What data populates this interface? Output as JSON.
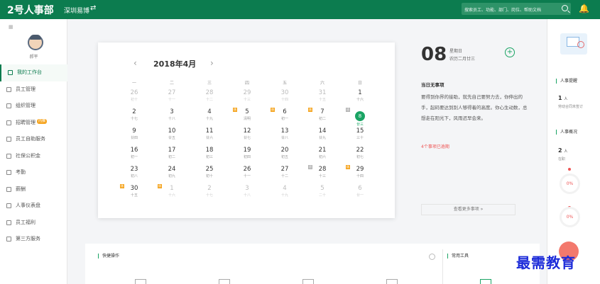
{
  "topbar": {
    "logo": "2号人事部",
    "company": "深圳易博",
    "search_placeholder": "搜索员工、功能、部门、岗位、帮助文档"
  },
  "user": {
    "name": "郝平"
  },
  "sidebar": {
    "items": [
      {
        "label": "我的工作台",
        "active": true
      },
      {
        "label": "员工管理"
      },
      {
        "label": "组织管理"
      },
      {
        "label": "招聘管理",
        "badge": "内推"
      },
      {
        "label": "员工自助服务"
      },
      {
        "label": "社保公积金"
      },
      {
        "label": "考勤"
      },
      {
        "label": "薪酬"
      },
      {
        "label": "人事仪表盘"
      },
      {
        "label": "员工福利"
      },
      {
        "label": "第三方服务"
      }
    ]
  },
  "calendar": {
    "title": "2018年4月",
    "weekdays": [
      "一",
      "二",
      "三",
      "四",
      "五",
      "六",
      "日"
    ],
    "weeks": [
      [
        {
          "n": "26",
          "l": "初十",
          "other": true
        },
        {
          "n": "27",
          "l": "十一",
          "other": true
        },
        {
          "n": "28",
          "l": "十二",
          "other": true
        },
        {
          "n": "29",
          "l": "十三",
          "other": true
        },
        {
          "n": "30",
          "l": "十四",
          "other": true
        },
        {
          "n": "31",
          "l": "十五",
          "other": true
        },
        {
          "n": "1",
          "l": "十六"
        }
      ],
      [
        {
          "n": "2",
          "l": "十七"
        },
        {
          "n": "3",
          "l": "十八"
        },
        {
          "n": "4",
          "l": "十九"
        },
        {
          "n": "5",
          "l": "清明",
          "tag": "休"
        },
        {
          "n": "6",
          "l": "初一",
          "tag": "休"
        },
        {
          "n": "7",
          "l": "初二",
          "tag": "休"
        },
        {
          "n": "8",
          "l": "廿三",
          "today": true,
          "tag": "班",
          "rest": true
        }
      ],
      [
        {
          "n": "9",
          "l": "廿四"
        },
        {
          "n": "10",
          "l": "廿五"
        },
        {
          "n": "11",
          "l": "廿六"
        },
        {
          "n": "12",
          "l": "廿七"
        },
        {
          "n": "13",
          "l": "廿八"
        },
        {
          "n": "14",
          "l": "廿九"
        },
        {
          "n": "15",
          "l": "三十"
        }
      ],
      [
        {
          "n": "16",
          "l": "初一"
        },
        {
          "n": "17",
          "l": "初二"
        },
        {
          "n": "18",
          "l": "初三"
        },
        {
          "n": "19",
          "l": "初四"
        },
        {
          "n": "20",
          "l": "初五"
        },
        {
          "n": "21",
          "l": "初六"
        },
        {
          "n": "22",
          "l": "初七"
        }
      ],
      [
        {
          "n": "23",
          "l": "初八"
        },
        {
          "n": "24",
          "l": "初九"
        },
        {
          "n": "25",
          "l": "初十"
        },
        {
          "n": "26",
          "l": "十一"
        },
        {
          "n": "27",
          "l": "十二"
        },
        {
          "n": "28",
          "l": "十三",
          "tag": "班",
          "rest": true
        },
        {
          "n": "29",
          "l": "十四",
          "tag": "休"
        }
      ],
      [
        {
          "n": "30",
          "l": "十五",
          "tag": "休"
        },
        {
          "n": "1",
          "l": "十六",
          "other": true,
          "tag": "休"
        },
        {
          "n": "2",
          "l": "十七",
          "other": true
        },
        {
          "n": "3",
          "l": "十八",
          "other": true
        },
        {
          "n": "4",
          "l": "十九",
          "other": true
        },
        {
          "n": "5",
          "l": "二十",
          "other": true
        },
        {
          "n": "6",
          "l": "廿一",
          "other": true
        }
      ]
    ]
  },
  "detail": {
    "day": "08",
    "weekday": "星期日",
    "lunar": "农历二月廿三",
    "no_event": "当日无事项",
    "quote": "要得到你界的接助，就先自己要努力去，你伸出的手，起码要达到别人够得着的高度。你心生动数，总想走在阳光下，风雨迟早会来。",
    "expire": "4个事项已逾期",
    "more": "查看更多事项 »"
  },
  "right_panel": {
    "reminder_title": "人事提醒",
    "reminder_count": "1",
    "reminder_unit": "人",
    "reminder_desc": "劳动合同未签订",
    "overview_title": "人事概况",
    "overview_count": "2",
    "overview_unit": "人",
    "overview_desc": "在职",
    "pct1": "0%",
    "pct2": "0%"
  },
  "bottom": {
    "quick_title": "快捷操作",
    "tools_title": "常用工具"
  },
  "watermark": "最需教育"
}
